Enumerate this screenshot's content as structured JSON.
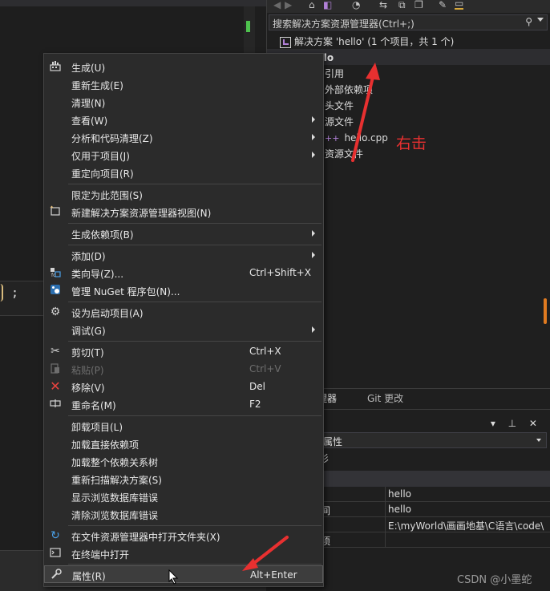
{
  "solution_explorer": {
    "search_placeholder": "搜索解决方案资源管理器(Ctrl+;)",
    "solution_label": "解决方案 'hello' (1 个项目，共 1 个)",
    "project": "hello",
    "nodes": [
      "引用",
      "外部依赖项",
      "头文件",
      "源文件",
      "hello.cpp",
      "资源文件"
    ]
  },
  "annotation": "右击",
  "tabs": {
    "active": "源管理器",
    "git": "Git 更改"
  },
  "properties": {
    "combo_value": "属性",
    "sub_label": "杉",
    "rows": [
      {
        "name": "",
        "value": "hello"
      },
      {
        "name": "间",
        "value": "hello"
      },
      {
        "name": "",
        "value": "E:\\myWorld\\画画地基\\C语言\\code\\"
      },
      {
        "name": "项",
        "value": ""
      }
    ]
  },
  "editor": {
    "code_glyph": ";"
  },
  "menu": {
    "items": [
      {
        "label": "生成(U)",
        "shortcut": "",
        "submenu": false,
        "disabled": false,
        "icon": "build-icon"
      },
      {
        "label": "重新生成(E)",
        "shortcut": "",
        "submenu": false,
        "disabled": false,
        "icon": ""
      },
      {
        "label": "清理(N)",
        "shortcut": "",
        "submenu": false,
        "disabled": false,
        "icon": ""
      },
      {
        "label": "查看(W)",
        "shortcut": "",
        "submenu": true,
        "disabled": false,
        "icon": ""
      },
      {
        "label": "分析和代码清理(Z)",
        "shortcut": "",
        "submenu": true,
        "disabled": false,
        "icon": ""
      },
      {
        "label": "仅用于项目(J)",
        "shortcut": "",
        "submenu": true,
        "disabled": false,
        "icon": ""
      },
      {
        "label": "重定向项目(R)",
        "shortcut": "",
        "submenu": false,
        "disabled": false,
        "icon": ""
      },
      {
        "label": "限定为此范围(S)",
        "shortcut": "",
        "submenu": false,
        "disabled": false,
        "icon": ""
      },
      {
        "label": "新建解决方案资源管理器视图(N)",
        "shortcut": "",
        "submenu": false,
        "disabled": false,
        "icon": "new-view-icon"
      },
      {
        "label": "生成依赖项(B)",
        "shortcut": "",
        "submenu": true,
        "disabled": false,
        "icon": ""
      },
      {
        "label": "添加(D)",
        "shortcut": "",
        "submenu": true,
        "disabled": false,
        "icon": ""
      },
      {
        "label": "类向导(Z)...",
        "shortcut": "Ctrl+Shift+X",
        "submenu": false,
        "disabled": false,
        "icon": "class-wizard-icon"
      },
      {
        "label": "管理 NuGet 程序包(N)...",
        "shortcut": "",
        "submenu": false,
        "disabled": false,
        "icon": "nuget-icon"
      },
      {
        "label": "设为启动项目(A)",
        "shortcut": "",
        "submenu": false,
        "disabled": false,
        "icon": "gear-icon"
      },
      {
        "label": "调试(G)",
        "shortcut": "",
        "submenu": true,
        "disabled": false,
        "icon": ""
      },
      {
        "label": "剪切(T)",
        "shortcut": "Ctrl+X",
        "submenu": false,
        "disabled": false,
        "icon": "scissors-icon"
      },
      {
        "label": "粘贴(P)",
        "shortcut": "Ctrl+V",
        "submenu": false,
        "disabled": true,
        "icon": "paste-icon"
      },
      {
        "label": "移除(V)",
        "shortcut": "Del",
        "submenu": false,
        "disabled": false,
        "icon": "remove-icon"
      },
      {
        "label": "重命名(M)",
        "shortcut": "F2",
        "submenu": false,
        "disabled": false,
        "icon": "rename-icon"
      },
      {
        "label": "卸载项目(L)",
        "shortcut": "",
        "submenu": false,
        "disabled": false,
        "icon": ""
      },
      {
        "label": "加载直接依赖项",
        "shortcut": "",
        "submenu": false,
        "disabled": false,
        "icon": ""
      },
      {
        "label": "加载整个依赖关系树",
        "shortcut": "",
        "submenu": false,
        "disabled": false,
        "icon": ""
      },
      {
        "label": "重新扫描解决方案(S)",
        "shortcut": "",
        "submenu": false,
        "disabled": false,
        "icon": ""
      },
      {
        "label": "显示浏览数据库错误",
        "shortcut": "",
        "submenu": false,
        "disabled": false,
        "icon": ""
      },
      {
        "label": "清除浏览数据库错误",
        "shortcut": "",
        "submenu": false,
        "disabled": false,
        "icon": ""
      },
      {
        "label": "在文件资源管理器中打开文件夹(X)",
        "shortcut": "",
        "submenu": false,
        "disabled": false,
        "icon": "refresh-icon"
      },
      {
        "label": "在终端中打开",
        "shortcut": "",
        "submenu": false,
        "disabled": false,
        "icon": "terminal-icon"
      },
      {
        "label": "属性(R)",
        "shortcut": "Alt+Enter",
        "submenu": false,
        "disabled": false,
        "icon": "wrench-icon"
      }
    ]
  },
  "colors": {
    "accent_red": "#e83030",
    "menu_bg": "#2b2b2b",
    "ide_bg": "#1f1f1f"
  },
  "watermark": "CSDN @小墨蛇"
}
